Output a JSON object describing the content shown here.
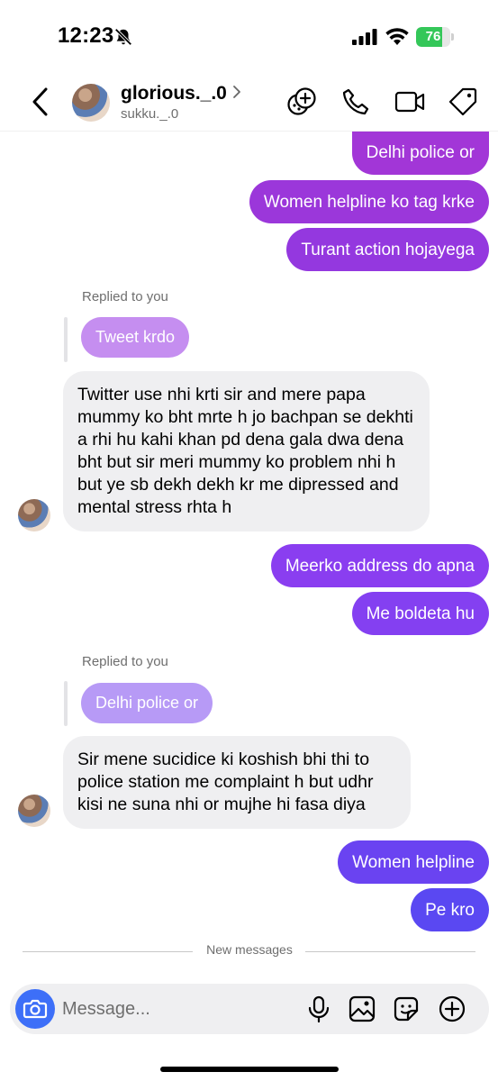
{
  "status_bar": {
    "time": "12:23",
    "battery_level": "76",
    "battery_fraction": 0.76,
    "icons": [
      "bell-slash-icon",
      "cellular-signal-icon",
      "wifi-icon",
      "battery-icon"
    ]
  },
  "header": {
    "username": "glorious._.0",
    "handle": "sukku._.0",
    "icons": [
      "back-chevron-icon",
      "chevron-right-icon",
      "add-effects-icon",
      "phone-icon",
      "video-camera-icon",
      "tag-icon"
    ]
  },
  "messages": {
    "out1": "Delhi police or",
    "out2": "Women helpline ko tag krke",
    "out3": "Turant action hojayega",
    "reply1_label": "Replied to you",
    "reply1_quote": "Tweet krdo",
    "in1": "Twitter use nhi krti sir and mere papa mummy ko bht mrte h jo bachpan se dekhti a rhi hu kahi khan pd dena gala dwa dena bht but sir meri mummy ko problem nhi h but ye sb dekh dekh kr me dipressed and mental stress rhta h",
    "out4": "Meerko address do apna",
    "out5": "Me boldeta hu",
    "reply2_label": "Replied to you",
    "reply2_quote": "Delhi police or",
    "in2": "Sir mene sucidice ki koshish bhi thi to police station me complaint h but udhr kisi ne suna nhi or mujhe hi fasa diya",
    "out6": "Women helpline",
    "out7": "Pe kro",
    "new_messages": "New messages"
  },
  "composer": {
    "placeholder": "Message...",
    "icons": [
      "camera-icon",
      "microphone-icon",
      "gallery-icon",
      "sticker-icon",
      "plus-circle-icon"
    ]
  },
  "colors": {
    "bubble_magenta": "#a236d7",
    "bubble_purple": "#8a3ef0",
    "bubble_indigo": "#6a43f1",
    "bubble_blue": "#5a48f2",
    "reply_quote_1": "#c58ef0",
    "reply_quote_2": "#b79af6",
    "camera_button": "#3d6ff8",
    "battery_green": "#34c759"
  }
}
